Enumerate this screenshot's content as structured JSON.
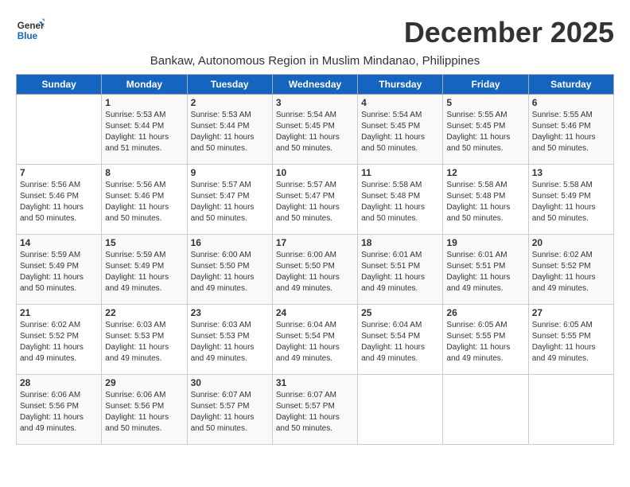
{
  "logo": {
    "line1": "General",
    "line2": "Blue"
  },
  "title": "December 2025",
  "subtitle": "Bankaw, Autonomous Region in Muslim Mindanao, Philippines",
  "weekdays": [
    "Sunday",
    "Monday",
    "Tuesday",
    "Wednesday",
    "Thursday",
    "Friday",
    "Saturday"
  ],
  "weeks": [
    [
      {
        "day": "",
        "info": ""
      },
      {
        "day": "1",
        "info": "Sunrise: 5:53 AM\nSunset: 5:44 PM\nDaylight: 11 hours\nand 51 minutes."
      },
      {
        "day": "2",
        "info": "Sunrise: 5:53 AM\nSunset: 5:44 PM\nDaylight: 11 hours\nand 50 minutes."
      },
      {
        "day": "3",
        "info": "Sunrise: 5:54 AM\nSunset: 5:45 PM\nDaylight: 11 hours\nand 50 minutes."
      },
      {
        "day": "4",
        "info": "Sunrise: 5:54 AM\nSunset: 5:45 PM\nDaylight: 11 hours\nand 50 minutes."
      },
      {
        "day": "5",
        "info": "Sunrise: 5:55 AM\nSunset: 5:45 PM\nDaylight: 11 hours\nand 50 minutes."
      },
      {
        "day": "6",
        "info": "Sunrise: 5:55 AM\nSunset: 5:46 PM\nDaylight: 11 hours\nand 50 minutes."
      }
    ],
    [
      {
        "day": "7",
        "info": "Sunrise: 5:56 AM\nSunset: 5:46 PM\nDaylight: 11 hours\nand 50 minutes."
      },
      {
        "day": "8",
        "info": "Sunrise: 5:56 AM\nSunset: 5:46 PM\nDaylight: 11 hours\nand 50 minutes."
      },
      {
        "day": "9",
        "info": "Sunrise: 5:57 AM\nSunset: 5:47 PM\nDaylight: 11 hours\nand 50 minutes."
      },
      {
        "day": "10",
        "info": "Sunrise: 5:57 AM\nSunset: 5:47 PM\nDaylight: 11 hours\nand 50 minutes."
      },
      {
        "day": "11",
        "info": "Sunrise: 5:58 AM\nSunset: 5:48 PM\nDaylight: 11 hours\nand 50 minutes."
      },
      {
        "day": "12",
        "info": "Sunrise: 5:58 AM\nSunset: 5:48 PM\nDaylight: 11 hours\nand 50 minutes."
      },
      {
        "day": "13",
        "info": "Sunrise: 5:58 AM\nSunset: 5:49 PM\nDaylight: 11 hours\nand 50 minutes."
      }
    ],
    [
      {
        "day": "14",
        "info": "Sunrise: 5:59 AM\nSunset: 5:49 PM\nDaylight: 11 hours\nand 50 minutes."
      },
      {
        "day": "15",
        "info": "Sunrise: 5:59 AM\nSunset: 5:49 PM\nDaylight: 11 hours\nand 49 minutes."
      },
      {
        "day": "16",
        "info": "Sunrise: 6:00 AM\nSunset: 5:50 PM\nDaylight: 11 hours\nand 49 minutes."
      },
      {
        "day": "17",
        "info": "Sunrise: 6:00 AM\nSunset: 5:50 PM\nDaylight: 11 hours\nand 49 minutes."
      },
      {
        "day": "18",
        "info": "Sunrise: 6:01 AM\nSunset: 5:51 PM\nDaylight: 11 hours\nand 49 minutes."
      },
      {
        "day": "19",
        "info": "Sunrise: 6:01 AM\nSunset: 5:51 PM\nDaylight: 11 hours\nand 49 minutes."
      },
      {
        "day": "20",
        "info": "Sunrise: 6:02 AM\nSunset: 5:52 PM\nDaylight: 11 hours\nand 49 minutes."
      }
    ],
    [
      {
        "day": "21",
        "info": "Sunrise: 6:02 AM\nSunset: 5:52 PM\nDaylight: 11 hours\nand 49 minutes."
      },
      {
        "day": "22",
        "info": "Sunrise: 6:03 AM\nSunset: 5:53 PM\nDaylight: 11 hours\nand 49 minutes."
      },
      {
        "day": "23",
        "info": "Sunrise: 6:03 AM\nSunset: 5:53 PM\nDaylight: 11 hours\nand 49 minutes."
      },
      {
        "day": "24",
        "info": "Sunrise: 6:04 AM\nSunset: 5:54 PM\nDaylight: 11 hours\nand 49 minutes."
      },
      {
        "day": "25",
        "info": "Sunrise: 6:04 AM\nSunset: 5:54 PM\nDaylight: 11 hours\nand 49 minutes."
      },
      {
        "day": "26",
        "info": "Sunrise: 6:05 AM\nSunset: 5:55 PM\nDaylight: 11 hours\nand 49 minutes."
      },
      {
        "day": "27",
        "info": "Sunrise: 6:05 AM\nSunset: 5:55 PM\nDaylight: 11 hours\nand 49 minutes."
      }
    ],
    [
      {
        "day": "28",
        "info": "Sunrise: 6:06 AM\nSunset: 5:56 PM\nDaylight: 11 hours\nand 49 minutes."
      },
      {
        "day": "29",
        "info": "Sunrise: 6:06 AM\nSunset: 5:56 PM\nDaylight: 11 hours\nand 50 minutes."
      },
      {
        "day": "30",
        "info": "Sunrise: 6:07 AM\nSunset: 5:57 PM\nDaylight: 11 hours\nand 50 minutes."
      },
      {
        "day": "31",
        "info": "Sunrise: 6:07 AM\nSunset: 5:57 PM\nDaylight: 11 hours\nand 50 minutes."
      },
      {
        "day": "",
        "info": ""
      },
      {
        "day": "",
        "info": ""
      },
      {
        "day": "",
        "info": ""
      }
    ]
  ]
}
